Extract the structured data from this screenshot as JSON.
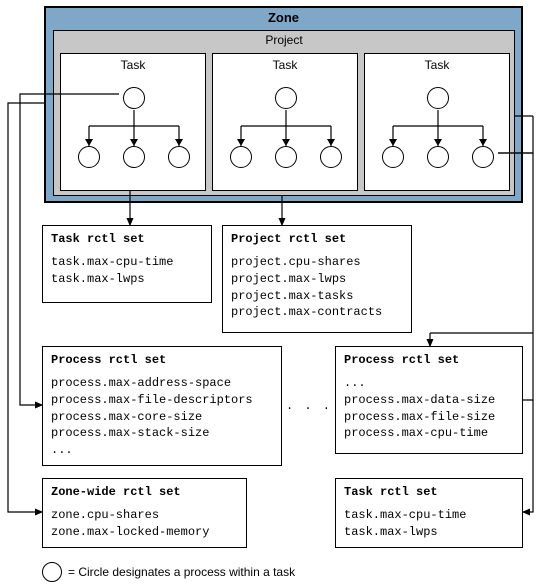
{
  "zone": {
    "title": "Zone",
    "project": {
      "title": "Project",
      "tasks": [
        {
          "label": "Task"
        },
        {
          "label": "Task"
        },
        {
          "label": "Task"
        }
      ]
    }
  },
  "boxes": {
    "task_rctl_left": {
      "title": "Task rctl set",
      "lines": [
        "task.max-cpu-time",
        "task.max-lwps"
      ]
    },
    "project_rctl": {
      "title": "Project rctl set",
      "lines": [
        "project.cpu-shares",
        "project.max-lwps",
        "project.max-tasks",
        "project.max-contracts"
      ]
    },
    "process_rctl_left": {
      "title": "Process rctl set",
      "lines": [
        "process.max-address-space",
        "process.max-file-descriptors",
        "process.max-core-size",
        "process.max-stack-size",
        "..."
      ]
    },
    "process_rctl_right": {
      "title": "Process rctl set",
      "lines": [
        "...",
        "process.max-data-size",
        "process.max-file-size",
        "process.max-cpu-time"
      ]
    },
    "zone_wide": {
      "title": "Zone-wide rctl set",
      "lines": [
        "zone.cpu-shares",
        "zone.max-locked-memory"
      ]
    },
    "task_rctl_right": {
      "title": "Task rctl set",
      "lines": [
        "task.max-cpu-time",
        "task.max-lwps"
      ]
    }
  },
  "dots": ". . . . .",
  "legend": {
    "text": "= Circle designates a process within a task"
  }
}
